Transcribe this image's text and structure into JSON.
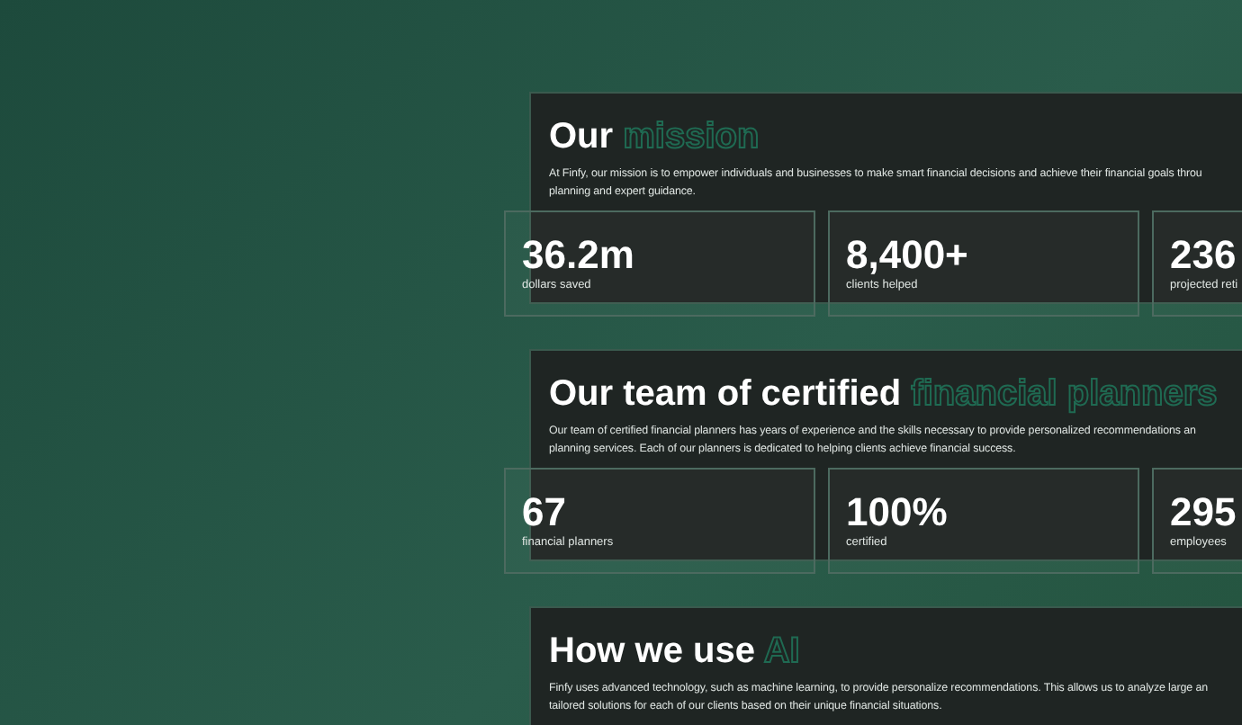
{
  "sections": [
    {
      "title": "Our",
      "title_accent": "mission",
      "lines": [
        "At Finfy, our mission is to empower individuals and businesses to make smart financial decisions and achieve their financial goals throu",
        "planning and expert guidance."
      ],
      "stats": [
        {
          "value": "36.2m",
          "label": "dollars saved"
        },
        {
          "value": "8,400+",
          "label": "clients helped"
        },
        {
          "value": "236",
          "label": "projected reti"
        }
      ]
    },
    {
      "title": "Our team of certified",
      "title_accent": "financial planners",
      "lines": [
        "Our team of certified financial planners has years of experience and the skills necessary to provide personalized recommendations an",
        "planning services. Each of our planners is dedicated to helping clients achieve financial success."
      ],
      "stats": [
        {
          "value": "67",
          "label": "financial planners"
        },
        {
          "value": "100%",
          "label": "certified"
        },
        {
          "value": "295",
          "label": "employees"
        }
      ]
    },
    {
      "title": "How we use",
      "title_accent": "AI",
      "lines": [
        "Finfy uses advanced technology, such as machine learning, to provide personalize recommendations. This allows us to analyze large an",
        "tailored solutions for each of our clients based on their unique financial situations."
      ]
    }
  ]
}
